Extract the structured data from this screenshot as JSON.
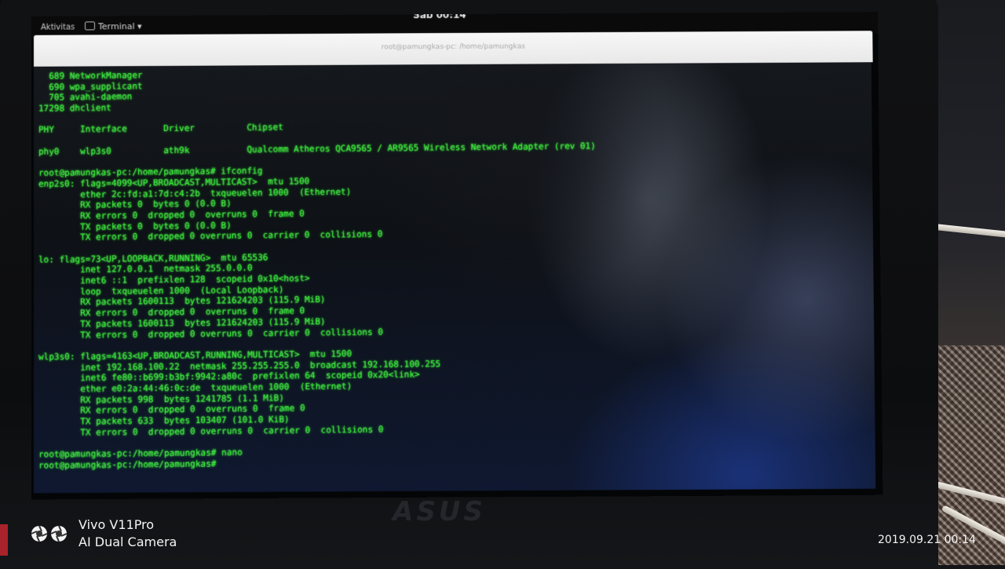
{
  "top_bar": {
    "activities": "Aktivitas",
    "app_menu": "Terminal ▾",
    "clock": "Sab 00:14"
  },
  "terminal": {
    "title": "root@pamungkas-pc: /home/pamungkas",
    "lines": [
      "  689 NetworkManager",
      "  690 wpa_supplicant",
      "  705 avahi-daemon",
      "17298 dhclient",
      "",
      "PHY     Interface       Driver          Chipset",
      "",
      "phy0    wlp3s0          ath9k           Qualcomm Atheros QCA9565 / AR9565 Wireless Network Adapter (rev 01)",
      "",
      "root@pamungkas-pc:/home/pamungkas# ifconfig",
      "enp2s0: flags=4099<UP,BROADCAST,MULTICAST>  mtu 1500",
      "        ether 2c:fd:a1:7d:c4:2b  txqueuelen 1000  (Ethernet)",
      "        RX packets 0  bytes 0 (0.0 B)",
      "        RX errors 0  dropped 0  overruns 0  frame 0",
      "        TX packets 0  bytes 0 (0.0 B)",
      "        TX errors 0  dropped 0 overruns 0  carrier 0  collisions 0",
      "",
      "lo: flags=73<UP,LOOPBACK,RUNNING>  mtu 65536",
      "        inet 127.0.0.1  netmask 255.0.0.0",
      "        inet6 ::1  prefixlen 128  scopeid 0x10<host>",
      "        loop  txqueuelen 1000  (Local Loopback)",
      "        RX packets 1600113  bytes 121624203 (115.9 MiB)",
      "        RX errors 0  dropped 0  overruns 0  frame 0",
      "        TX packets 1600113  bytes 121624203 (115.9 MiB)",
      "        TX errors 0  dropped 0 overruns 0  carrier 0  collisions 0",
      "",
      "wlp3s0: flags=4163<UP,BROADCAST,RUNNING,MULTICAST>  mtu 1500",
      "        inet 192.168.100.22  netmask 255.255.255.0  broadcast 192.168.100.255",
      "        inet6 fe80::b699:b3bf:9942:a80c  prefixlen 64  scopeid 0x20<link>",
      "        ether e0:2a:44:46:0c:de  txqueuelen 1000  (Ethernet)",
      "        RX packets 998  bytes 1241785 (1.1 MiB)",
      "        RX errors 0  dropped 0  overruns 0  frame 0",
      "        TX packets 633  bytes 103407 (101.0 KiB)",
      "        TX errors 0  dropped 0 overruns 0  carrier 0  collisions 0",
      "",
      "root@pamungkas-pc:/home/pamungkas# nano",
      "root@pamungkas-pc:/home/pamungkas#"
    ]
  },
  "laptop": {
    "brand": "ASUS"
  },
  "watermark": {
    "model": "Vivo V11Pro",
    "camera": "AI Dual Camera",
    "timestamp": "2019.09.21 00:14"
  },
  "colors": {
    "terminal_text": "#3df23d",
    "titlebar": "#f2f2f2"
  }
}
